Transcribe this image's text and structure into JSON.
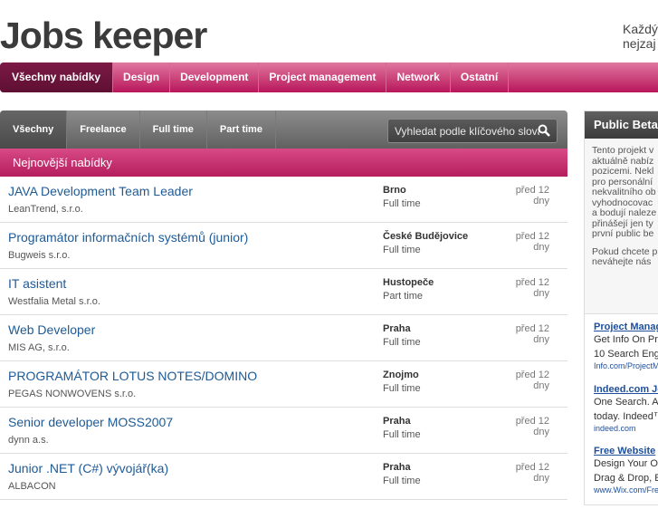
{
  "header": {
    "logo": "Jobs keeper",
    "slogan_line1": "Každý",
    "slogan_line2": "nejzaj"
  },
  "mainnav": [
    "Všechny nabídky",
    "Design",
    "Development",
    "Project management",
    "Network",
    "Ostatní"
  ],
  "subnav": {
    "tabs": [
      "Všechny",
      "Freelance",
      "Full time",
      "Part time"
    ],
    "search_placeholder": "Vyhledat podle klíčového slova"
  },
  "list": {
    "heading": "Nejnovější nabídky",
    "jobs": [
      {
        "title": "JAVA Development Team Leader",
        "company": "LeanTrend, s.r.o.",
        "city": "Brno",
        "type": "Full time",
        "age1": "před 12",
        "age2": "dny"
      },
      {
        "title": "Programátor informačních systémů (junior)",
        "company": "Bugweis s.r.o.",
        "city": "České Budějovice",
        "type": "Full time",
        "age1": "před 12",
        "age2": "dny"
      },
      {
        "title": "IT asistent",
        "company": "Westfalia Metal s.r.o.",
        "city": "Hustopeče",
        "type": "Part time",
        "age1": "před 12",
        "age2": "dny"
      },
      {
        "title": "Web Developer",
        "company": "MIS AG, s.r.o.",
        "city": "Praha",
        "type": "Full time",
        "age1": "před 12",
        "age2": "dny"
      },
      {
        "title": "PROGRAMÁTOR LOTUS NOTES/DOMINO",
        "company": "PEGAS NONWOVENS s.r.o.",
        "city": "Znojmo",
        "type": "Full time",
        "age1": "před 12",
        "age2": "dny"
      },
      {
        "title": "Senior developer MOSS2007",
        "company": "dynn a.s.",
        "city": "Praha",
        "type": "Full time",
        "age1": "před 12",
        "age2": "dny"
      },
      {
        "title": "Junior .NET (C#) vývojář(ka)",
        "company": "ALBACON",
        "city": "Praha",
        "type": "Full time",
        "age1": "před 12",
        "age2": "dny"
      }
    ]
  },
  "sidebar": {
    "heading": "Public Beta",
    "para1": "Tento projekt v\naktuálně nabíz\npozicemi. Nekl\npro personální\nnekvalitního ob\nvyhodnocovac\na bodují naleze\npřinášejí jen ty\nprvní public be",
    "para2": "Pokud chcete p\nneváhejte nás"
  },
  "ads": [
    {
      "title": "Project Manag",
      "line1": "Get Info On Pro",
      "line2": "10 Search Eng",
      "url": "Info.com/ProjectM"
    },
    {
      "title": "Indeed.com Jo",
      "line1": "One Search. A",
      "line2": "today. Indeed™",
      "url": "indeed.com"
    },
    {
      "title": "Free Website",
      "line1": "Design Your O",
      "line2": "Drag & Drop, E",
      "url": "www.Wix.com/Fre"
    }
  ]
}
